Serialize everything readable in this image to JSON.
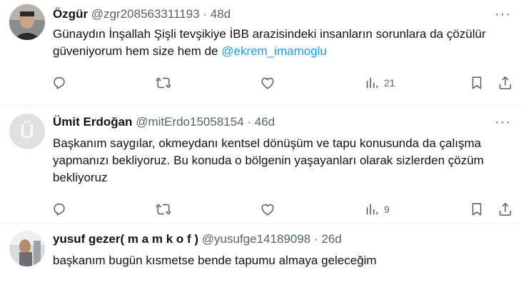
{
  "tweets": [
    {
      "name": "Özgür",
      "handle": "@zgr208563311193",
      "dot": "·",
      "time": "48d",
      "text": "Günaydın İnşallah Şişli tevşikiye İBB arazisindeki insanların sorunlara da çözülür güveniyorum hem size hem de ",
      "mention": "@ekrem_imamoglu",
      "views": "21",
      "avatar_icon": "profile-photo"
    },
    {
      "name": "Ümit Erdoğan",
      "handle": "@mitErdo15058154",
      "dot": "·",
      "time": "46d",
      "text": "Başkanım saygılar, okmeydanı kentsel dönüşüm ve tapu konusunda da çalışma yapmanızı bekliyoruz. Bu konuda o bölgenin yaşayanları olarak sizlerden çözüm bekliyoruz",
      "views": "9",
      "avatar_letter": "Ü"
    },
    {
      "name": "yusuf gezer( m a m k o f )",
      "handle": "@yusufge14189098",
      "dot": "·",
      "time": "26d",
      "text": "başkanım bugün kısmetse bende tapumu almaya geleceğim",
      "avatar_icon": "profile-photo"
    }
  ],
  "more_icon": "···",
  "colors": {
    "text": "#0f1419",
    "secondary": "#536471",
    "link": "#1d9bf0",
    "divider": "#eff3f4"
  }
}
